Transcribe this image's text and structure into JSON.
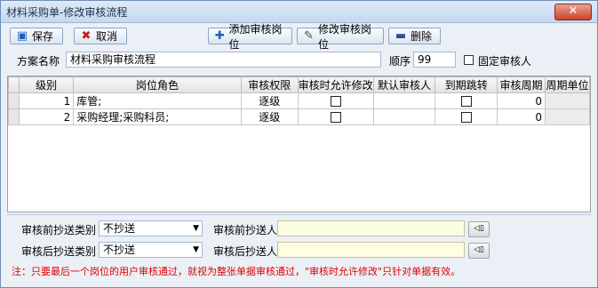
{
  "window": {
    "title": "材料采购单-修改审核流程",
    "close_symbol": "✕"
  },
  "toolbar": {
    "save_label": "保存",
    "cancel_label": "取消",
    "add_label": "添加审核岗位",
    "edit_label": "修改审核岗位",
    "delete_label": "删除"
  },
  "form": {
    "plan_name_label": "方案名称",
    "plan_name_value": "材料采购审核流程",
    "order_label": "顺序",
    "order_value": "99",
    "fixed_reviewer_label": "固定审核人"
  },
  "table": {
    "columns": [
      "级别",
      "岗位角色",
      "审核权限",
      "审核时允许修改",
      "默认审核人",
      "到期跳转",
      "审核周期",
      "周期单位"
    ],
    "rows": [
      {
        "level": "1",
        "role": "库管;",
        "permission": "逐级",
        "allow_edit": false,
        "default_reviewer": "",
        "expire_jump": false,
        "cycle": "0",
        "unit": ""
      },
      {
        "level": "2",
        "role": "采购经理;采购科员;",
        "permission": "逐级",
        "allow_edit": false,
        "default_reviewer": "",
        "expire_jump": false,
        "cycle": "0",
        "unit": ""
      }
    ]
  },
  "copy": {
    "pre_type_label": "审核前抄送类别",
    "pre_type_value": "不抄送",
    "pre_person_label": "审核前抄送人",
    "post_type_label": "审核后抄送类别",
    "post_type_value": "不抄送",
    "post_person_label": "审核后抄送人"
  },
  "note": "注：只要最后一个岗位的用户审核通过，就视为整张单据审核通过，\"审核时允许修改\"只针对单据有效。",
  "colors": {
    "note_red": "#e00000",
    "accent_blue": "#1f5fbf",
    "delete_blue": "#2a4f9c",
    "cancel_red": "#c0201a",
    "yellow_input": "#fdfde2"
  }
}
